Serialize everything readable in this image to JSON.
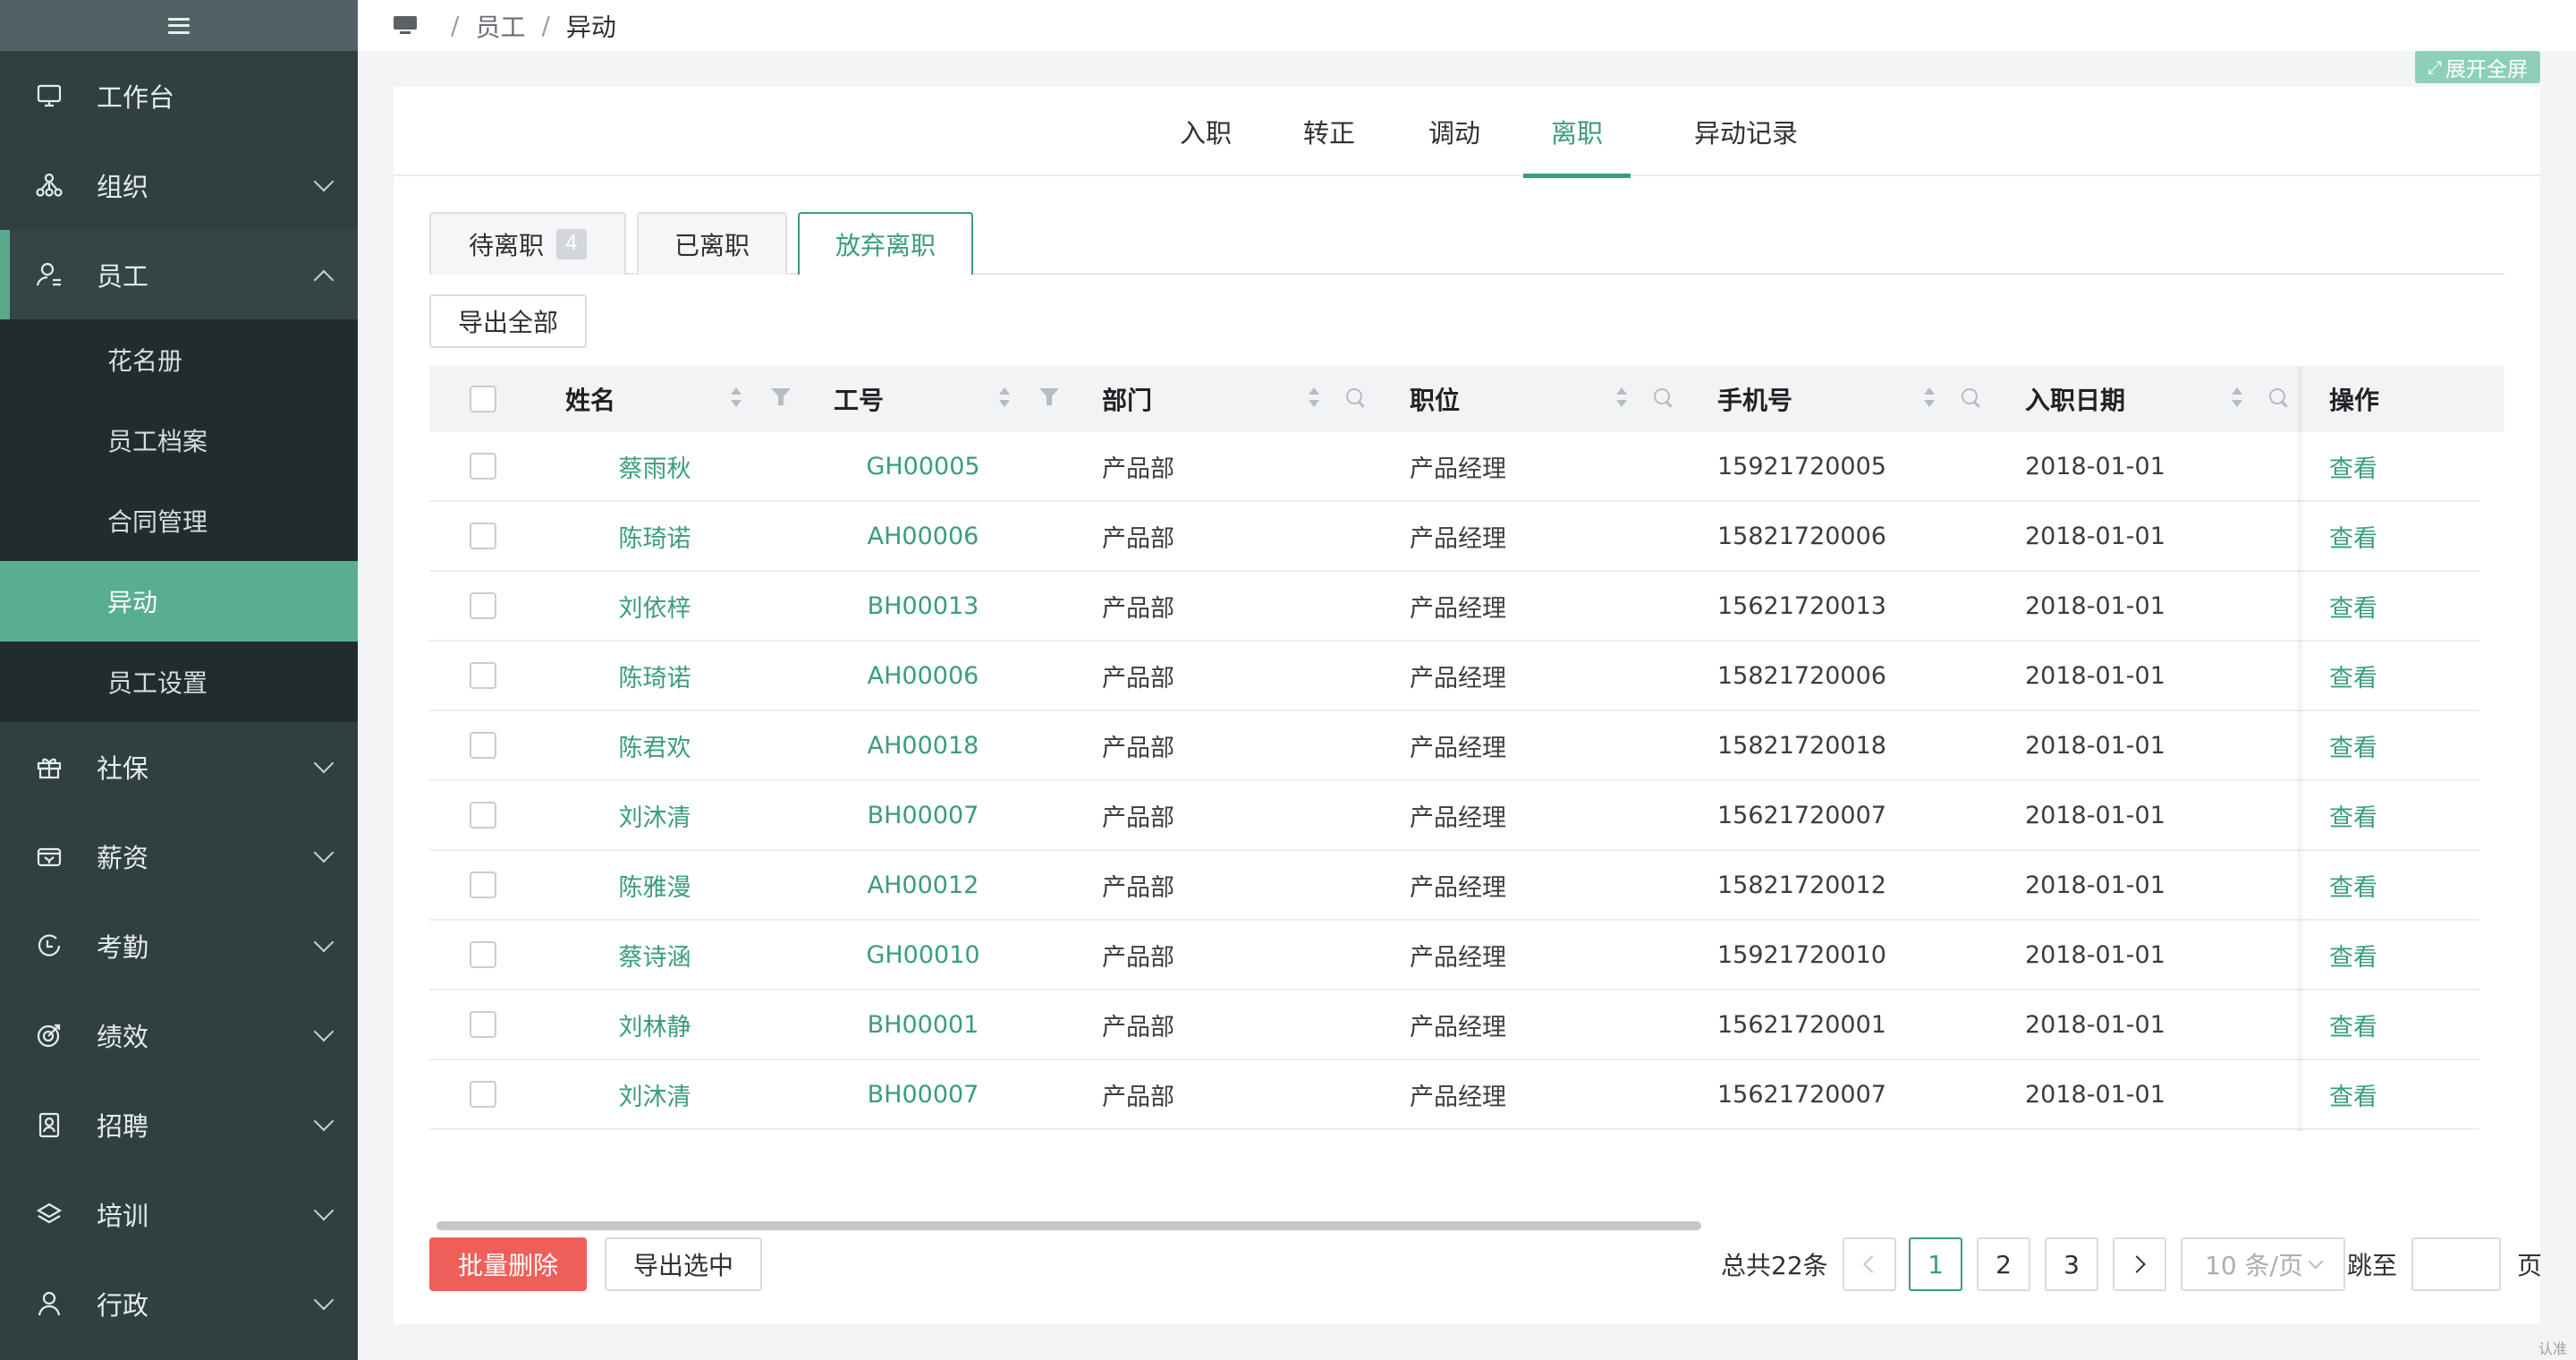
{
  "sidebar": {
    "items": [
      {
        "label": "工作台",
        "icon": "monitor-icon"
      },
      {
        "label": "组织",
        "icon": "org-icon"
      },
      {
        "label": "员工",
        "icon": "user-icon"
      },
      {
        "label": "社保",
        "icon": "gift-icon"
      },
      {
        "label": "薪资",
        "icon": "wallet-icon"
      },
      {
        "label": "考勤",
        "icon": "clock-icon"
      },
      {
        "label": "绩效",
        "icon": "target-icon"
      },
      {
        "label": "招聘",
        "icon": "badge-icon"
      },
      {
        "label": "培训",
        "icon": "layers-icon"
      },
      {
        "label": "行政",
        "icon": "person-icon"
      }
    ],
    "submenu": [
      "花名册",
      "员工档案",
      "合同管理",
      "异动",
      "员工设置"
    ]
  },
  "breadcrumb": {
    "level1": "员工",
    "current": "异动"
  },
  "fullscreen_label": "展开全屏",
  "main_tabs": [
    "入职",
    "转正",
    "调动",
    "离职",
    "异动记录"
  ],
  "sub_tabs": {
    "pending": "待离职",
    "pending_count": "4",
    "done": "已离职",
    "abandoned": "放弃离职"
  },
  "actions": {
    "export_all": "导出全部",
    "batch_delete": "批量删除",
    "export_selected": "导出选中"
  },
  "table": {
    "headers": [
      "姓名",
      "工号",
      "部门",
      "职位",
      "手机号",
      "入职日期",
      "操作"
    ],
    "rows": [
      {
        "name": "蔡雨秋",
        "id": "GH00005",
        "dept": "产品部",
        "pos": "产品经理",
        "phone": "15921720005",
        "date": "2018-01-01",
        "op": "查看"
      },
      {
        "name": "陈琦诺",
        "id": "AH00006",
        "dept": "产品部",
        "pos": "产品经理",
        "phone": "15821720006",
        "date": "2018-01-01",
        "op": "查看"
      },
      {
        "name": "刘依梓",
        "id": "BH00013",
        "dept": "产品部",
        "pos": "产品经理",
        "phone": "15621720013",
        "date": "2018-01-01",
        "op": "查看"
      },
      {
        "name": "陈琦诺",
        "id": "AH00006",
        "dept": "产品部",
        "pos": "产品经理",
        "phone": "15821720006",
        "date": "2018-01-01",
        "op": "查看"
      },
      {
        "name": "陈君欢",
        "id": "AH00018",
        "dept": "产品部",
        "pos": "产品经理",
        "phone": "15821720018",
        "date": "2018-01-01",
        "op": "查看"
      },
      {
        "name": "刘沐清",
        "id": "BH00007",
        "dept": "产品部",
        "pos": "产品经理",
        "phone": "15621720007",
        "date": "2018-01-01",
        "op": "查看"
      },
      {
        "name": "陈雅漫",
        "id": "AH00012",
        "dept": "产品部",
        "pos": "产品经理",
        "phone": "15821720012",
        "date": "2018-01-01",
        "op": "查看"
      },
      {
        "name": "蔡诗涵",
        "id": "GH00010",
        "dept": "产品部",
        "pos": "产品经理",
        "phone": "15921720010",
        "date": "2018-01-01",
        "op": "查看"
      },
      {
        "name": "刘林静",
        "id": "BH00001",
        "dept": "产品部",
        "pos": "产品经理",
        "phone": "15621720001",
        "date": "2018-01-01",
        "op": "查看"
      },
      {
        "name": "刘沐清",
        "id": "BH00007",
        "dept": "产品部",
        "pos": "产品经理",
        "phone": "15621720007",
        "date": "2018-01-01",
        "op": "查看"
      }
    ]
  },
  "pagination": {
    "total": "总共22条",
    "pages": [
      "1",
      "2",
      "3"
    ],
    "page_size": "10 条/页",
    "jump_label": "跳至",
    "page_suffix": "页"
  },
  "watermark": "认准",
  "colors": {
    "primary": "#3a9d7c",
    "sidebar": "#304041",
    "danger": "#ef5f5a"
  }
}
